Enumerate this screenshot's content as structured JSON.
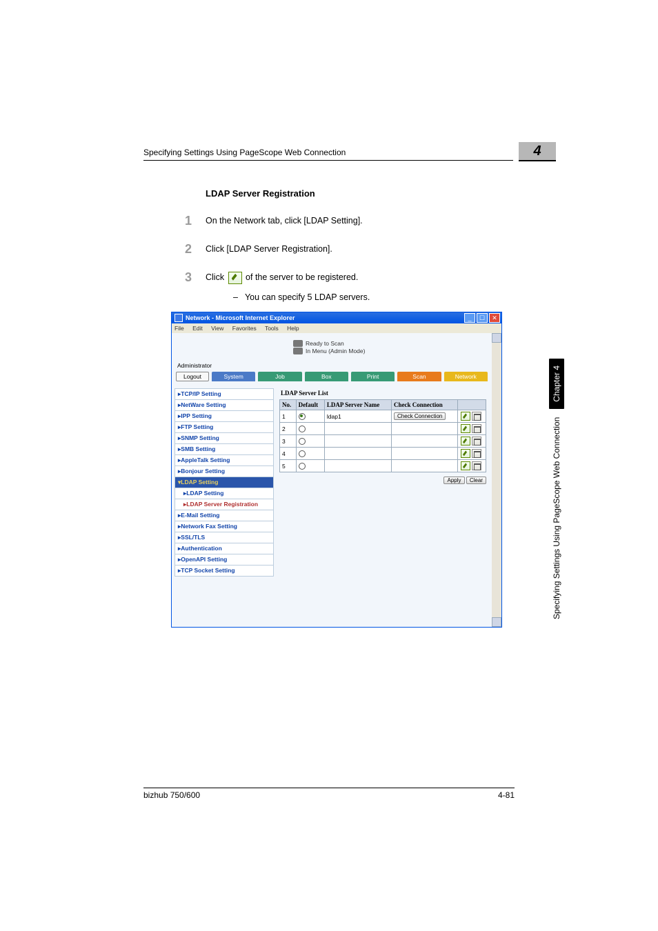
{
  "running_head": "Specifying Settings Using PageScope Web Connection",
  "chapter_badge": "4",
  "section_title": "LDAP Server Registration",
  "steps": [
    {
      "num": "1",
      "text": "On the Network tab, click [LDAP Setting]."
    },
    {
      "num": "2",
      "text": "Click [LDAP Server Registration]."
    },
    {
      "num": "3",
      "text_before": "Click ",
      "text_after": " of the server to be registered."
    }
  ],
  "step3_sub": "You can specify 5 LDAP servers.",
  "browser": {
    "title": "Network - Microsoft Internet Explorer",
    "menu": [
      "File",
      "Edit",
      "View",
      "Favorites",
      "Tools",
      "Help"
    ],
    "status1": "Ready to Scan",
    "status2": "In Menu (Admin Mode)",
    "admin": "Administrator",
    "logout": "Logout",
    "tabs": {
      "system": "System",
      "job": "Job",
      "box": "Box",
      "print": "Print",
      "scan": "Scan",
      "network": "Network"
    },
    "sidebar": [
      "TCP/IP Setting",
      "NetWare Setting",
      "IPP Setting",
      "FTP Setting",
      "SNMP Setting",
      "SMB Setting",
      "AppleTalk Setting",
      "Bonjour Setting"
    ],
    "sidebar_expanded": "LDAP Setting",
    "sidebar_sub1": "LDAP Setting",
    "sidebar_sub2": "LDAP Server Registration",
    "sidebar_after": [
      "E-Mail Setting",
      "Network Fax Setting",
      "SSL/TLS",
      "Authentication",
      "OpenAPI Setting",
      "TCP Socket Setting"
    ],
    "panel_title": "LDAP Server List",
    "columns": {
      "no": "No.",
      "default": "Default",
      "name": "LDAP Server Name",
      "check": "Check Connection"
    },
    "rows": [
      {
        "no": "1",
        "default": true,
        "name": "ldap1",
        "check": "Check Connection"
      },
      {
        "no": "2",
        "default": false,
        "name": "",
        "check": ""
      },
      {
        "no": "3",
        "default": false,
        "name": "",
        "check": ""
      },
      {
        "no": "4",
        "default": false,
        "name": "",
        "check": ""
      },
      {
        "no": "5",
        "default": false,
        "name": "",
        "check": ""
      }
    ],
    "apply": "Apply",
    "clear": "Clear"
  },
  "footer_left": "bizhub 750/600",
  "footer_right": "4-81",
  "side_text": "Specifying Settings Using PageScope Web Connection",
  "side_chapter": "Chapter 4"
}
